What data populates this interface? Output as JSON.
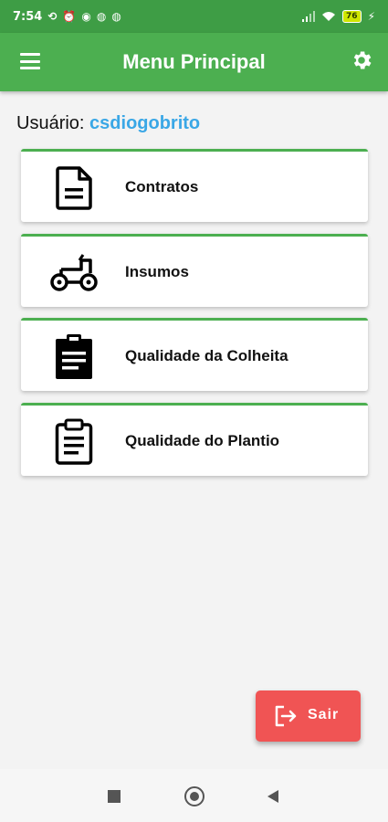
{
  "status_bar": {
    "time": "7:54",
    "battery": "76"
  },
  "app_bar": {
    "title": "Menu Principal"
  },
  "user": {
    "label": "Usuário:",
    "name": "csdiogobrito"
  },
  "menu": {
    "items": [
      {
        "label": "Contratos",
        "icon": "document-icon"
      },
      {
        "label": "Insumos",
        "icon": "tractor-icon"
      },
      {
        "label": "Qualidade da Colheita",
        "icon": "clipboard-filled-icon"
      },
      {
        "label": "Qualidade do Plantio",
        "icon": "clipboard-outline-icon"
      }
    ]
  },
  "logout": {
    "label": "Sair"
  },
  "colors": {
    "primary": "#4caf50",
    "status_bar": "#3e9d45",
    "accent_user": "#3aa7e6",
    "logout_button": "#f05454"
  }
}
